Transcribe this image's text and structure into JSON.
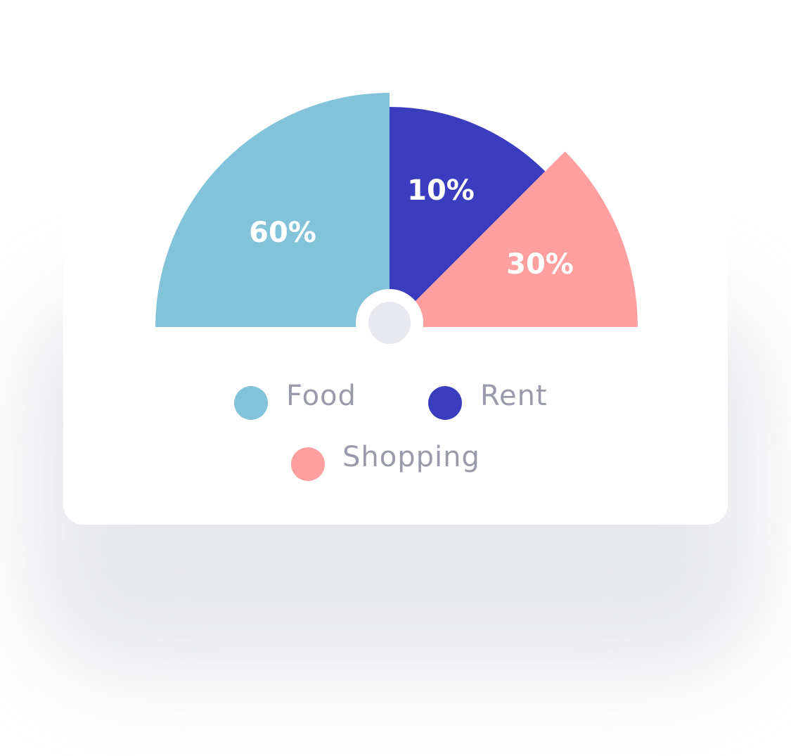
{
  "chart_data": {
    "type": "pie",
    "variant": "semicircle",
    "slices": [
      {
        "label": "Food",
        "value": 60,
        "display": "60%",
        "color": "#82C3DA"
      },
      {
        "label": "Rent",
        "value": 10,
        "display": "10%",
        "color": "#3B3DBF"
      },
      {
        "label": "Shopping",
        "value": 30,
        "display": "30%",
        "color": "#FF9F9F"
      }
    ],
    "center_hub_color": "#E8E9EE",
    "legend_text_color": "#9A9BAA",
    "label_color": "#FFFFFF",
    "legend": [
      {
        "label": "Food",
        "color": "#82C3DA"
      },
      {
        "label": "Rent",
        "color": "#3B3DBF"
      },
      {
        "label": "Shopping",
        "color": "#FF9F9F"
      }
    ]
  }
}
